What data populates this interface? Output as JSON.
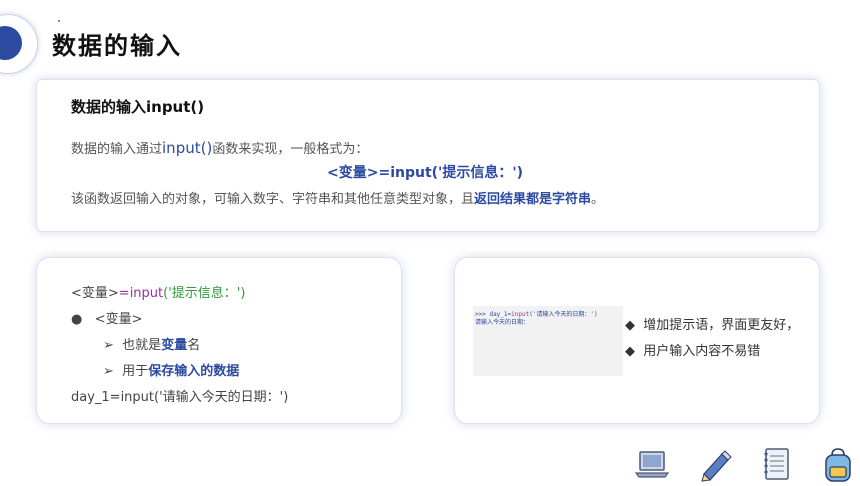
{
  "header": {
    "title": "数据的输入"
  },
  "top_box": {
    "title": "数据的输入input()",
    "line1_pre": "数据的输入通过",
    "line1_func": "input()",
    "line1_post": "函数来实现，一般格式为：",
    "syntax": "<变量>=input('提示信息：')",
    "line3_pre": "该函数返回输入的对象，可输入数字、字符串和其他任意类型对象，且",
    "line3_bold": "返回结果都是字符串",
    "line3_end": "。"
  },
  "left_box": {
    "l1_a": "<变量>",
    "l1_b": "=input",
    "l1_c": "('提示信息：')",
    "l2": "<变量>",
    "l3_pre": "也就是",
    "l3_bold": "变量",
    "l3_post": "名",
    "l4_pre": "用于",
    "l4_bold": "保存输入的数据",
    "l5": "day_1=input('请输入今天的日期：')",
    "bullet_dot": "●",
    "bullet_arrow": "➢"
  },
  "right_box": {
    "code_line1_prompt": ">>> ",
    "code_line1_var": "day_1=",
    "code_line1_func": "input",
    "code_line1_arg": "('请输入今天的日期：')",
    "code_line2": "请输入今天的日期：",
    "b1": "增加提示语，界面更友好，",
    "b2": "用户输入内容不易错",
    "diamond": "◆"
  },
  "icons": [
    "laptop-icon",
    "pencil-icon",
    "notebook-icon",
    "backpack-icon"
  ],
  "colors": {
    "accent": "#2c4aa0",
    "func": "#9b2fa3",
    "string": "#2e9a3a"
  }
}
